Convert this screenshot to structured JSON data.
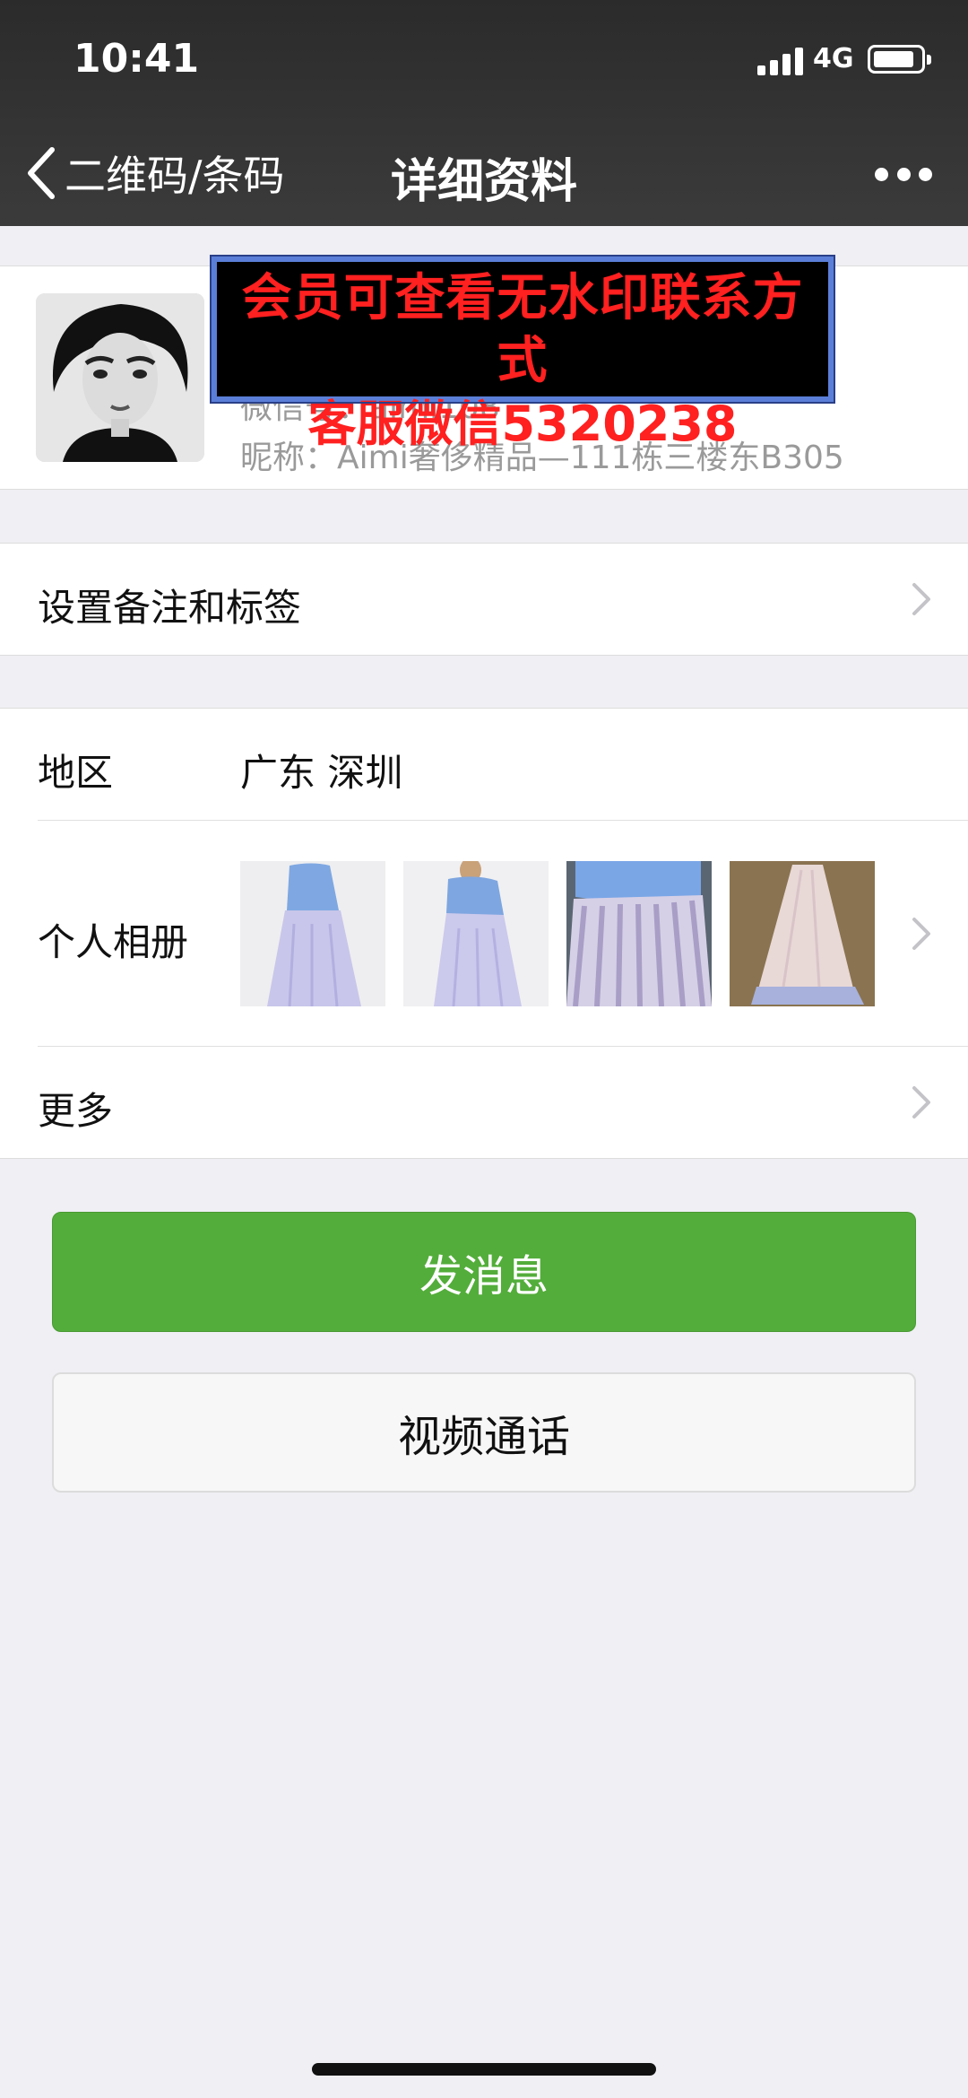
{
  "status_bar": {
    "time": "10:41",
    "network": "4G"
  },
  "nav": {
    "back_label": "二维码/条码",
    "title": "详细资料"
  },
  "profile": {
    "wechat_id": "微信号：aimi108",
    "nickname": "昵称：Aimi奢侈精品—111栋三楼东B305"
  },
  "watermark": {
    "line1": "会员可查看无水印联系方式",
    "line2": "客服微信5320238"
  },
  "rows": {
    "remark": {
      "label": "设置备注和标签"
    },
    "region": {
      "label": "地区",
      "value": "广东  深圳"
    },
    "album": {
      "label": "个人相册"
    },
    "more": {
      "label": "更多"
    }
  },
  "buttons": {
    "message": "发消息",
    "video_call": "视频通话"
  },
  "colors": {
    "header_bg": "#333333",
    "primary_green": "#53ad3a",
    "page_bg": "#efeff4"
  }
}
